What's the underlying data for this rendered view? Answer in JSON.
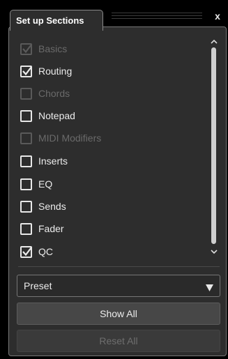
{
  "header": {
    "tab_label": "Set up Sections",
    "close_label": "x"
  },
  "sections": [
    {
      "label": "Basics",
      "checked": true,
      "disabled": true
    },
    {
      "label": "Routing",
      "checked": true,
      "disabled": false
    },
    {
      "label": "Chords",
      "checked": false,
      "disabled": true
    },
    {
      "label": "Notepad",
      "checked": false,
      "disabled": false
    },
    {
      "label": "MIDI Modifiers",
      "checked": false,
      "disabled": true
    },
    {
      "label": "Inserts",
      "checked": false,
      "disabled": false
    },
    {
      "label": "EQ",
      "checked": false,
      "disabled": false
    },
    {
      "label": "Sends",
      "checked": false,
      "disabled": false
    },
    {
      "label": "Fader",
      "checked": false,
      "disabled": false
    },
    {
      "label": "QC",
      "checked": true,
      "disabled": false
    }
  ],
  "preset": {
    "value": "Preset",
    "icon": "triangle-down-icon"
  },
  "buttons": {
    "show_all": "Show All",
    "reset_all": "Reset All"
  },
  "colors": {
    "panel_bg": "#2d2d2d",
    "text": "#ececec",
    "disabled_text": "#6a6a6a"
  }
}
